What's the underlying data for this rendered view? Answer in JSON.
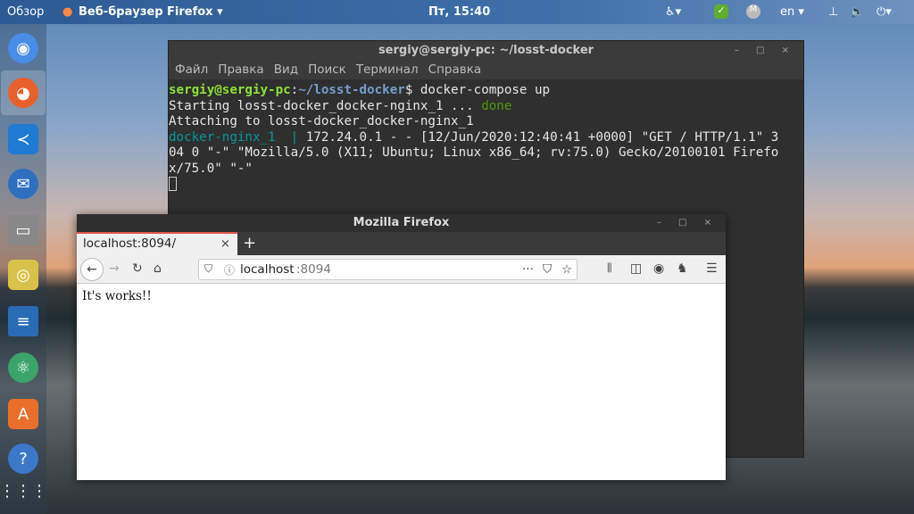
{
  "topbar": {
    "overview": "Обзор",
    "app_menu": "Веб-браузер Firefox ▾",
    "clock": "Пт, 15:40",
    "lang": "en ▾"
  },
  "dock": {
    "items": [
      "Chromium",
      "Firefox",
      "VS Code",
      "Thunderbird",
      "Files",
      "Rhythmbox",
      "LibreOffice Writer",
      "Atom",
      "Ubuntu Software",
      "Help",
      "Show Applications"
    ]
  },
  "terminal": {
    "title": "sergiy@sergiy-pc: ~/losst-docker",
    "menu": [
      "Файл",
      "Правка",
      "Вид",
      "Поиск",
      "Терминал",
      "Справка"
    ],
    "prompt_user": "sergiy@sergiy-pc",
    "prompt_path": "~/losst-docker",
    "command": "$ docker-compose up",
    "line2": "Starting losst-docker_docker-nginx_1 ... ",
    "line2_status": "done",
    "line3": "Attaching to losst-docker_docker-nginx_1",
    "line4_service": "docker-nginx_1  | ",
    "line4": "172.24.0.1 - - [12/Jun/2020:12:40:41 +0000] \"GET / HTTP/1.1\" 3",
    "line5": "04 0 \"-\" \"Mozilla/5.0 (X11; Ubuntu; Linux x86_64; rv:75.0) Gecko/20100101 Firefo",
    "line6": "x/75.0\" \"-\""
  },
  "firefox": {
    "title": "Mozilla Firefox",
    "tab_label": "localhost:8094/",
    "url_host": "localhost",
    "url_port": ":8094",
    "page_text": "It's works!!"
  },
  "window_controls": "– □ ×"
}
